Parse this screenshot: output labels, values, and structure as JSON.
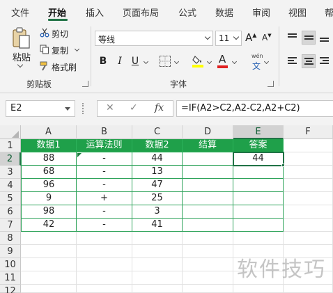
{
  "ribbon": {
    "tabs": [
      {
        "label": "文件",
        "active": false
      },
      {
        "label": "开始",
        "active": true
      },
      {
        "label": "插入",
        "active": false
      },
      {
        "label": "页面布局",
        "active": false
      },
      {
        "label": "公式",
        "active": false
      },
      {
        "label": "数据",
        "active": false
      },
      {
        "label": "审阅",
        "active": false
      },
      {
        "label": "视图",
        "active": false
      },
      {
        "label": "帮",
        "active": false
      }
    ],
    "clipboard": {
      "paste_label": "粘贴",
      "cut_label": "剪切",
      "copy_label": "复制",
      "format_painter_label": "格式刷",
      "group_label": "剪贴板"
    },
    "font": {
      "font_name": "等线",
      "font_size": "11",
      "grow_label": "A",
      "shrink_label": "A",
      "bold_label": "B",
      "italic_label": "I",
      "underline_label": "U",
      "font_color_label": "A",
      "phonetic_label": "wén",
      "phonetic_char": "文",
      "group_label": "字体",
      "fill_color": "#ffff00",
      "font_color": "#e02020"
    }
  },
  "formula_bar": {
    "name_box": "E2",
    "cancel_symbol": "✕",
    "enter_symbol": "✓",
    "fx_label": "fx",
    "formula": "=IF(A2>C2,A2-C2,A2+C2)"
  },
  "sheet": {
    "columns": [
      "A",
      "B",
      "C",
      "D",
      "E",
      "F"
    ],
    "rows": [
      "1",
      "2",
      "3",
      "4",
      "5",
      "6",
      "7",
      "8",
      "9",
      "10",
      "11",
      "12"
    ],
    "active_cell": "E2",
    "header_fill": "#1fa04a",
    "header": [
      "数据1",
      "运算法则",
      "数据2",
      "结算",
      "答案"
    ],
    "data": [
      [
        "88",
        "-",
        "44",
        "",
        "44"
      ],
      [
        "68",
        "-",
        "13",
        "",
        ""
      ],
      [
        "96",
        "-",
        "47",
        "",
        ""
      ],
      [
        "9",
        "+",
        "25",
        "",
        ""
      ],
      [
        "98",
        "-",
        "3",
        "",
        ""
      ],
      [
        "42",
        "-",
        "41",
        "",
        ""
      ]
    ]
  },
  "watermark": "软件技巧"
}
